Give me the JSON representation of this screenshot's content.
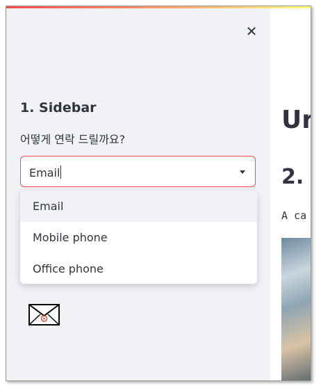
{
  "sidebar": {
    "close_icon": "close-icon",
    "title": "1. Sidebar",
    "select_label": "어떻게 연락 드릴까요?",
    "select_value": "Email",
    "options": [
      "Email",
      "Mobile phone",
      "Office phone"
    ],
    "image_icon": "envelope-icon"
  },
  "main": {
    "title": "Ur",
    "subtitle": "2. (",
    "text": "A ca"
  },
  "colors": {
    "accent": "#ff4b4b",
    "sidebar_bg": "#f0f2f6",
    "text": "#31333f"
  }
}
